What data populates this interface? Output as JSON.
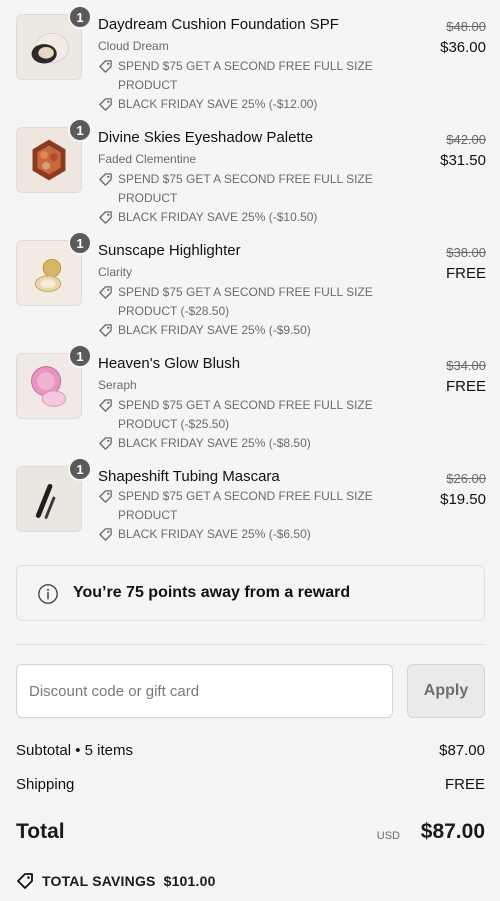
{
  "items": [
    {
      "quantity": "1",
      "thumb_icon": "cushion-compact",
      "name": "Daydream Cushion Foundation SPF",
      "variant": "Cloud Dream",
      "discounts": [
        "SPEND $75 GET A SECOND FREE FULL SIZE PRODUCT",
        "BLACK FRIDAY SAVE 25% (-$12.00)"
      ],
      "compare_price": "$48.00",
      "price": "$36.00"
    },
    {
      "quantity": "1",
      "thumb_icon": "eyeshadow-palette",
      "name": "Divine Skies Eyeshadow Palette",
      "variant": "Faded Clementine",
      "discounts": [
        "SPEND $75 GET A SECOND FREE FULL SIZE PRODUCT",
        "BLACK FRIDAY SAVE 25% (-$10.50)"
      ],
      "compare_price": "$42.00",
      "price": "$31.50"
    },
    {
      "quantity": "1",
      "thumb_icon": "highlighter-compact",
      "name": "Sunscape Highlighter",
      "variant": "Clarity",
      "discounts": [
        "SPEND $75 GET A SECOND FREE FULL SIZE PRODUCT (-$28.50)",
        "BLACK FRIDAY SAVE 25% (-$9.50)"
      ],
      "compare_price": "$38.00",
      "price": "FREE"
    },
    {
      "quantity": "1",
      "thumb_icon": "blush-compact",
      "name": "Heaven's Glow Blush",
      "variant": "Seraph",
      "discounts": [
        "SPEND $75 GET A SECOND FREE FULL SIZE PRODUCT (-$25.50)",
        "BLACK FRIDAY SAVE 25% (-$8.50)"
      ],
      "compare_price": "$34.00",
      "price": "FREE"
    },
    {
      "quantity": "1",
      "thumb_icon": "mascara-tube",
      "name": "Shapeshift Tubing Mascara",
      "variant": "",
      "discounts": [
        "SPEND $75 GET A SECOND FREE FULL SIZE PRODUCT",
        "BLACK FRIDAY SAVE 25% (-$6.50)"
      ],
      "compare_price": "$26.00",
      "price": "$19.50"
    }
  ],
  "reward": {
    "icon": "info-icon",
    "text": "You’re 75 points away from a reward"
  },
  "discount_field": {
    "placeholder": "Discount code or gift card",
    "value": ""
  },
  "apply_label": "Apply",
  "summary": {
    "subtotal_label": "Subtotal • 5 items",
    "subtotal_value": "$87.00",
    "shipping_label": "Shipping",
    "shipping_value": "FREE",
    "total_label": "Total",
    "currency": "USD",
    "total_value": "$87.00"
  },
  "savings": {
    "icon": "tag-icon",
    "label": "TOTAL SAVINGS",
    "value": "$101.00"
  }
}
